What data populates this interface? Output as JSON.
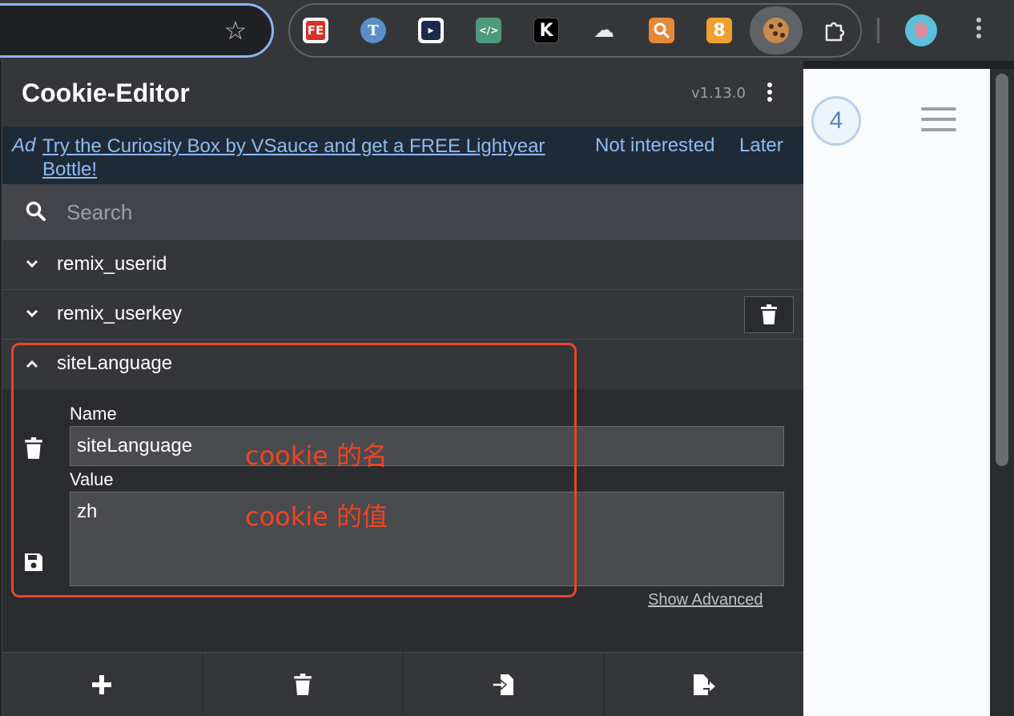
{
  "browser": {
    "extensions": [
      {
        "name": "fe-helper-icon",
        "text": "FE",
        "color": "#d93025"
      },
      {
        "name": "t-icon",
        "text": "T",
        "color": "#5b8fc8"
      },
      {
        "name": "arrow-ext-icon",
        "text": "▸",
        "color": "#ffffff"
      },
      {
        "name": "code-ext-icon",
        "text": "</>",
        "color": "#3e9e7a"
      },
      {
        "name": "k-ext-icon",
        "text": "K",
        "color": "#000000"
      },
      {
        "name": "cloud-ext-icon",
        "text": "☁",
        "color": "#35363a"
      },
      {
        "name": "magnifier-ext-icon",
        "text": "🔍",
        "color": "#e8883a"
      },
      {
        "name": "eight-ext-icon",
        "text": "8",
        "color": "#f0a030"
      }
    ]
  },
  "popup": {
    "title": "Cookie-Editor",
    "version": "v1.13.0"
  },
  "ad": {
    "label": "Ad",
    "link_text": "Try the Curiosity Box by VSauce and get a FREE Lightyear Bottle!",
    "not_interested": "Not interested",
    "later": "Later"
  },
  "search": {
    "placeholder": "Search"
  },
  "cookies": [
    {
      "name": "remix_userid"
    },
    {
      "name": "remix_userkey"
    },
    {
      "name": "siteLanguage"
    }
  ],
  "editor": {
    "name_label": "Name",
    "name_value": "siteLanguage",
    "value_label": "Value",
    "value_value": "zh",
    "show_advanced": "Show Advanced"
  },
  "annotations": {
    "name_note": "cookie 的名",
    "value_note": "cookie 的值"
  },
  "page": {
    "badge": "4"
  },
  "colors": {
    "accent": "#8ab4f8",
    "annotation": "#e8452c",
    "ad_bg": "#1e2a37"
  }
}
